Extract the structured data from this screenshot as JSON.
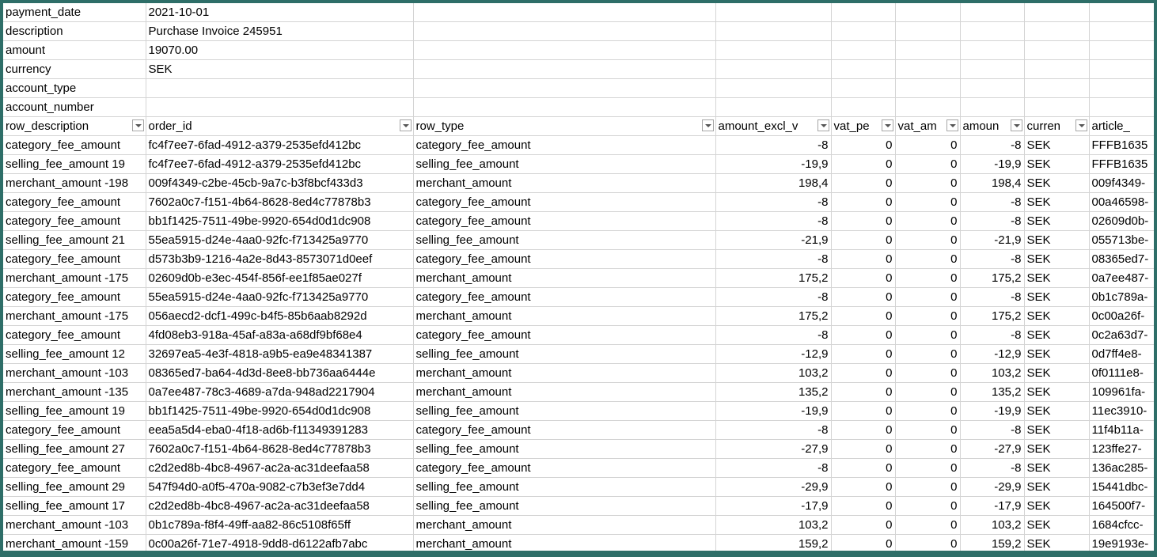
{
  "meta_rows": [
    {
      "label": "payment_date",
      "value": "2021-10-01"
    },
    {
      "label": "description",
      "value": "Purchase Invoice 245951"
    },
    {
      "label": "amount",
      "value": "19070.00"
    },
    {
      "label": "currency",
      "value": "SEK"
    },
    {
      "label": "account_type",
      "value": ""
    },
    {
      "label": "account_number",
      "value": ""
    }
  ],
  "headers": [
    "row_description",
    "order_id",
    "row_type",
    "amount_excl_v",
    "vat_pe",
    "vat_am",
    "amoun",
    "curren",
    "article_"
  ],
  "rows": [
    [
      "category_fee_amount",
      "fc4f7ee7-6fad-4912-a379-2535efd412bc",
      "category_fee_amount",
      "-8",
      "0",
      "0",
      "-8",
      "SEK",
      "FFFB1635"
    ],
    [
      "selling_fee_amount 19",
      "fc4f7ee7-6fad-4912-a379-2535efd412bc",
      "selling_fee_amount",
      "-19,9",
      "0",
      "0",
      "-19,9",
      "SEK",
      "FFFB1635"
    ],
    [
      "merchant_amount -198",
      "009f4349-c2be-45cb-9a7c-b3f8bcf433d3",
      "merchant_amount",
      "198,4",
      "0",
      "0",
      "198,4",
      "SEK",
      "009f4349-"
    ],
    [
      "category_fee_amount",
      "7602a0c7-f151-4b64-8628-8ed4c77878b3",
      "category_fee_amount",
      "-8",
      "0",
      "0",
      "-8",
      "SEK",
      "00a46598-"
    ],
    [
      "category_fee_amount",
      "bb1f1425-7511-49be-9920-654d0d1dc908",
      "category_fee_amount",
      "-8",
      "0",
      "0",
      "-8",
      "SEK",
      "02609d0b-"
    ],
    [
      "selling_fee_amount 21",
      "55ea5915-d24e-4aa0-92fc-f713425a9770",
      "selling_fee_amount",
      "-21,9",
      "0",
      "0",
      "-21,9",
      "SEK",
      "055713be-"
    ],
    [
      "category_fee_amount",
      "d573b3b9-1216-4a2e-8d43-8573071d0eef",
      "category_fee_amount",
      "-8",
      "0",
      "0",
      "-8",
      "SEK",
      "08365ed7-"
    ],
    [
      "merchant_amount -175",
      "02609d0b-e3ec-454f-856f-ee1f85ae027f",
      "merchant_amount",
      "175,2",
      "0",
      "0",
      "175,2",
      "SEK",
      "0a7ee487-"
    ],
    [
      "category_fee_amount",
      "55ea5915-d24e-4aa0-92fc-f713425a9770",
      "category_fee_amount",
      "-8",
      "0",
      "0",
      "-8",
      "SEK",
      "0b1c789a-"
    ],
    [
      "merchant_amount -175",
      "056aecd2-dcf1-499c-b4f5-85b6aab8292d",
      "merchant_amount",
      "175,2",
      "0",
      "0",
      "175,2",
      "SEK",
      "0c00a26f-"
    ],
    [
      "category_fee_amount",
      "4fd08eb3-918a-45af-a83a-a68df9bf68e4",
      "category_fee_amount",
      "-8",
      "0",
      "0",
      "-8",
      "SEK",
      "0c2a63d7-"
    ],
    [
      "selling_fee_amount 12",
      "32697ea5-4e3f-4818-a9b5-ea9e48341387",
      "selling_fee_amount",
      "-12,9",
      "0",
      "0",
      "-12,9",
      "SEK",
      "0d7ff4e8-"
    ],
    [
      "merchant_amount -103",
      "08365ed7-ba64-4d3d-8ee8-bb736aa6444e",
      "merchant_amount",
      "103,2",
      "0",
      "0",
      "103,2",
      "SEK",
      "0f0111e8-"
    ],
    [
      "merchant_amount -135",
      "0a7ee487-78c3-4689-a7da-948ad2217904",
      "merchant_amount",
      "135,2",
      "0",
      "0",
      "135,2",
      "SEK",
      "109961fa-"
    ],
    [
      "selling_fee_amount 19",
      "bb1f1425-7511-49be-9920-654d0d1dc908",
      "selling_fee_amount",
      "-19,9",
      "0",
      "0",
      "-19,9",
      "SEK",
      "11ec3910-"
    ],
    [
      "category_fee_amount",
      "eea5a5d4-eba0-4f18-ad6b-f11349391283",
      "category_fee_amount",
      "-8",
      "0",
      "0",
      "-8",
      "SEK",
      "11f4b11a-"
    ],
    [
      "selling_fee_amount 27",
      "7602a0c7-f151-4b64-8628-8ed4c77878b3",
      "selling_fee_amount",
      "-27,9",
      "0",
      "0",
      "-27,9",
      "SEK",
      "123ffe27-"
    ],
    [
      "category_fee_amount",
      "c2d2ed8b-4bc8-4967-ac2a-ac31deefaa58",
      "category_fee_amount",
      "-8",
      "0",
      "0",
      "-8",
      "SEK",
      "136ac285-"
    ],
    [
      "selling_fee_amount 29",
      "547f94d0-a0f5-470a-9082-c7b3ef3e7dd4",
      "selling_fee_amount",
      "-29,9",
      "0",
      "0",
      "-29,9",
      "SEK",
      "15441dbc-"
    ],
    [
      "selling_fee_amount 17",
      "c2d2ed8b-4bc8-4967-ac2a-ac31deefaa58",
      "selling_fee_amount",
      "-17,9",
      "0",
      "0",
      "-17,9",
      "SEK",
      "164500f7-"
    ],
    [
      "merchant_amount -103",
      "0b1c789a-f8f4-49ff-aa82-86c5108f65ff",
      "merchant_amount",
      "103,2",
      "0",
      "0",
      "103,2",
      "SEK",
      "1684cfcc-"
    ],
    [
      "merchant_amount -159",
      "0c00a26f-71e7-4918-9dd8-d6122afb7abc",
      "merchant_amount",
      "159,2",
      "0",
      "0",
      "159,2",
      "SEK",
      "19e9193e-"
    ]
  ]
}
